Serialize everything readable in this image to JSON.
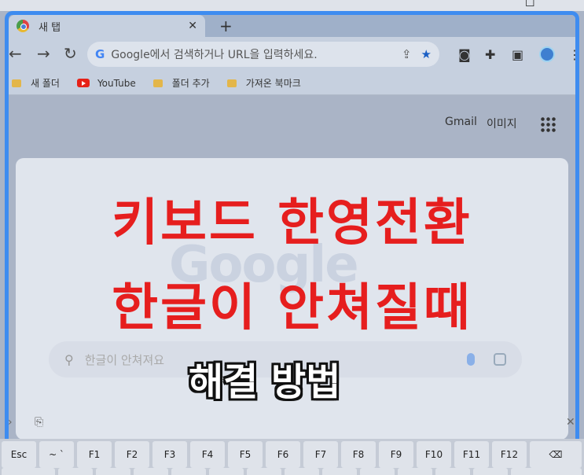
{
  "browser": {
    "tab_title": "새 탭",
    "tab_close": "✕",
    "new_tab": "+",
    "omnibox_logo": "G",
    "omnibox_placeholder": "Google에서 검색하거나 URL을 입력하세요.",
    "bookmarks": [
      "새 폴더",
      "YouTube",
      "폴더 추가",
      "가져온 북마크"
    ],
    "header_links": [
      "Gmail",
      "이미지"
    ]
  },
  "google": {
    "ghost_logo": "Google",
    "search_text": "한글이 안쳐져요"
  },
  "overlay": {
    "line1": "키보드 한영전환",
    "line2": "한글이 안쳐질때",
    "subtitle": "해결 방법"
  },
  "keyboard": {
    "keys": [
      "Esc",
      "~ `",
      "F1",
      "F2",
      "F3",
      "F4",
      "F5",
      "F6",
      "F7",
      "F8",
      "F9",
      "F10",
      "F11",
      "F12",
      "⌫"
    ]
  },
  "colors": {
    "accent_blue": "#3e8cf0",
    "title_red": "#e61e1e"
  }
}
